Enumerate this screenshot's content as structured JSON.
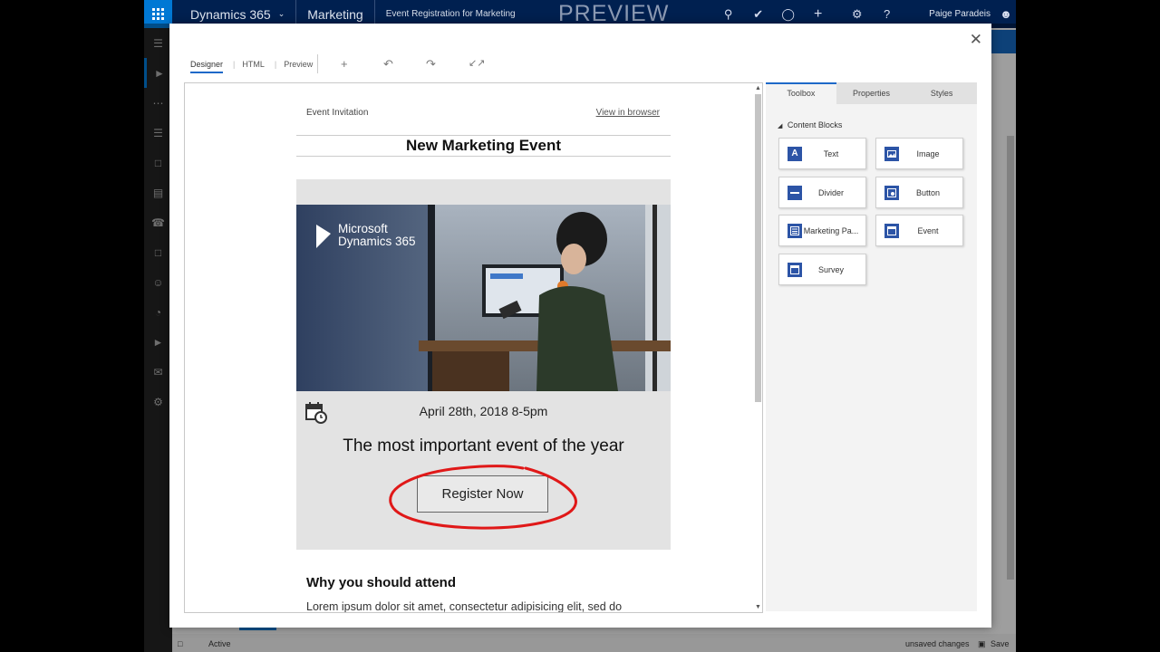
{
  "topbar": {
    "app_name": "Dynamics 365",
    "module": "Marketing",
    "breadcrumb": "Event Registration for Marketing",
    "mode_label": "PREVIEW",
    "user_name": "Paige Paradeis",
    "icons": [
      "search-icon",
      "task-icon",
      "lightbulb-icon",
      "add-icon",
      "settings-icon",
      "help-icon",
      "user-icon"
    ]
  },
  "leftnav": {
    "icons": [
      "hamburger-icon",
      "marketing-icon",
      "more-icon",
      "segments-icon",
      "pages-icon",
      "forms-icon",
      "phone-icon",
      "events-icon",
      "contacts-icon",
      "analytics-icon",
      "campaign-icon",
      "mail-icon",
      "settings-icon"
    ]
  },
  "statusbar": {
    "state": "Active",
    "unsaved": "unsaved changes",
    "save_label": "Save"
  },
  "editor": {
    "tabs": [
      {
        "label": "Designer"
      },
      {
        "label": "HTML"
      },
      {
        "label": "Preview"
      }
    ],
    "tools": [
      "add-icon",
      "undo-icon",
      "redo-icon",
      "collapse-icon"
    ]
  },
  "email": {
    "header_left": "Event Invitation",
    "view_in_browser": "View in browser",
    "title": "New Marketing Event",
    "hero_logo_line1": "Microsoft",
    "hero_logo_line2": "Dynamics 365",
    "event_date": "April 28th, 2018 8-5pm",
    "tagline": "The most important event of the year",
    "register_label": "Register Now",
    "section_heading": "Why you should attend",
    "body_text": "Lorem ipsum dolor sit amet, consectetur adipisicing elit, sed do"
  },
  "sidepanel": {
    "tabs": [
      "Toolbox",
      "Properties",
      "Styles"
    ],
    "section_label": "Content Blocks",
    "blocks": [
      {
        "label": "Text",
        "icon": "text-icon"
      },
      {
        "label": "Image",
        "icon": "image-icon"
      },
      {
        "label": "Divider",
        "icon": "divider-icon"
      },
      {
        "label": "Button",
        "icon": "button-icon"
      },
      {
        "label": "Marketing Pa...",
        "icon": "marketing-page-icon"
      },
      {
        "label": "Event",
        "icon": "event-icon"
      },
      {
        "label": "Survey",
        "icon": "survey-icon"
      }
    ]
  },
  "colors": {
    "topbar": "#002050",
    "accent": "#0078d4",
    "highlight_circle": "#e01818",
    "block_icon": "#2c54a6"
  }
}
